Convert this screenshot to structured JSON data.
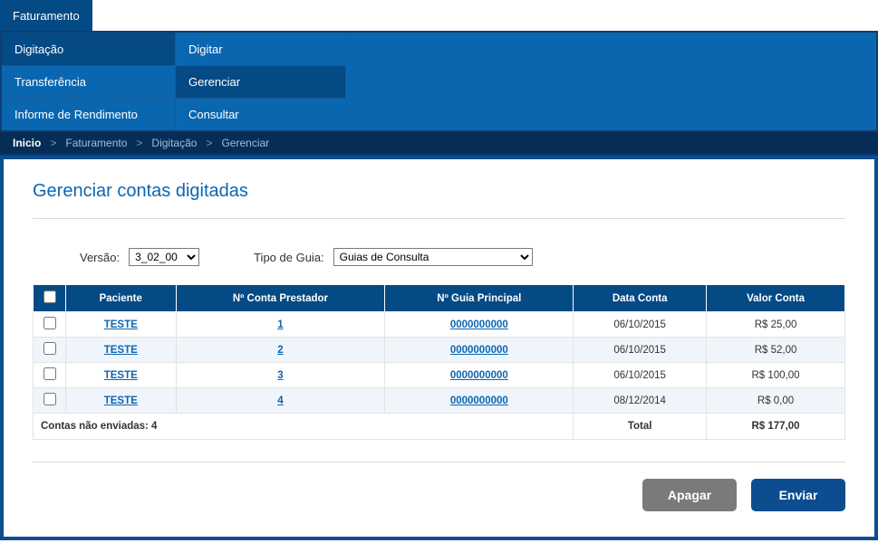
{
  "tabs": {
    "faturamento": "Faturamento"
  },
  "menu": {
    "col1": [
      {
        "name": "digitacao",
        "label": "Digitação",
        "current": true
      },
      {
        "name": "transferencia",
        "label": "Transferência",
        "current": false
      },
      {
        "name": "informe-rendimento",
        "label": "Informe de Rendimento",
        "current": false
      }
    ],
    "col2": [
      {
        "name": "digitar",
        "label": "Digitar",
        "current": false
      },
      {
        "name": "gerenciar",
        "label": "Gerenciar",
        "current": true
      },
      {
        "name": "consultar",
        "label": "Consultar",
        "current": false
      }
    ]
  },
  "breadcrumb": {
    "root": "Inicio",
    "items": [
      "Faturamento",
      "Digitação",
      "Gerenciar"
    ]
  },
  "page": {
    "title": "Gerenciar contas digitadas"
  },
  "filters": {
    "versao": {
      "label": "Versão:",
      "value": "3_02_00"
    },
    "tipoguia": {
      "label": "Tipo de Guia:",
      "value": "Guias de Consulta"
    }
  },
  "table": {
    "headers": {
      "paciente": "Paciente",
      "conta_prestador": "Nº Conta Prestador",
      "guia_principal": "Nº Guia Principal",
      "data_conta": "Data Conta",
      "valor_conta": "Valor Conta"
    },
    "rows": [
      {
        "paciente": "TESTE",
        "conta": "1",
        "guia": "0000000000",
        "data": "06/10/2015",
        "valor": "R$ 25,00"
      },
      {
        "paciente": "TESTE",
        "conta": "2",
        "guia": "0000000000",
        "data": "06/10/2015",
        "valor": "R$ 52,00"
      },
      {
        "paciente": "TESTE",
        "conta": "3",
        "guia": "0000000000",
        "data": "06/10/2015",
        "valor": "R$ 100,00"
      },
      {
        "paciente": "TESTE",
        "conta": "4",
        "guia": "0000000000",
        "data": "08/12/2014",
        "valor": "R$ 0,00"
      }
    ],
    "footer": {
      "count_label": "Contas não enviadas: 4",
      "total_label": "Total",
      "total_value": "R$ 177,00"
    }
  },
  "buttons": {
    "apagar": "Apagar",
    "enviar": "Enviar"
  }
}
